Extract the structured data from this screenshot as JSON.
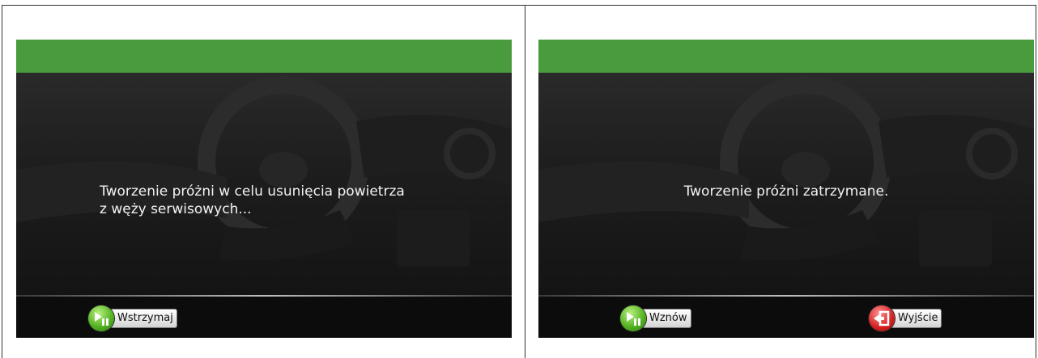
{
  "left_screen": {
    "message": "Tworzenie próżni w celu usunięcia powietrza\nz węży serwisowych...",
    "pause_button": {
      "label": "Wstrzymaj",
      "icon": "play-pause-icon"
    }
  },
  "right_screen": {
    "message": "Tworzenie próżni zatrzymane.",
    "resume_button": {
      "label": "Wznów",
      "icon": "play-pause-icon"
    },
    "exit_button": {
      "label": "Wyjście",
      "icon": "exit-door-icon"
    }
  },
  "colors": {
    "header_green": "#4a9a3e",
    "background_dark": "#101010",
    "text": "#f2f2f2"
  }
}
